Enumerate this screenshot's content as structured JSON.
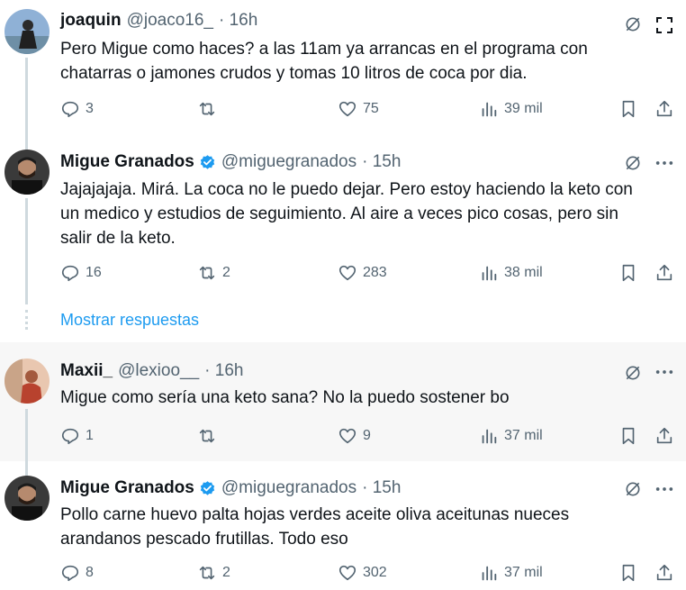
{
  "tweets": [
    {
      "name": "joaquin",
      "handle": "@joaco16_",
      "time": "· 16h",
      "text_lines": [
        "Pero Migue como haces? a las 11am ya arrancas en el programa con",
        "chatarras o jamones crudos y tomas 10 litros de coca por dia."
      ],
      "replies": "3",
      "retweets": "",
      "likes": "75",
      "views": "39 mil",
      "verified": false
    },
    {
      "name": "Migue Granados",
      "handle": "@miguegranados",
      "time": "· 15h",
      "text_lines": [
        "Jajajajaja. Mirá. La coca no le puedo dejar. Pero estoy haciendo la keto con",
        "un medico y estudios de seguimiento. Al aire a veces pico cosas, pero sin",
        "salir de la keto."
      ],
      "replies": "16",
      "retweets": "2",
      "likes": "283",
      "views": "38 mil",
      "verified": true
    },
    {
      "name": "Maxii_",
      "handle": "@lexioo__",
      "time": "· 16h",
      "text_lines": [
        "Migue como sería una keto sana? No la puedo sostener bo"
      ],
      "replies": "1",
      "retweets": "",
      "likes": "9",
      "views": "37 mil",
      "verified": false
    },
    {
      "name": "Migue Granados",
      "handle": "@miguegranados",
      "time": "· 15h",
      "text_lines": [
        "Pollo carne huevo palta hojas verdes aceite oliva aceitunas nueces",
        "arandanos pescado frutillas. Todo eso"
      ],
      "replies": "8",
      "retweets": "2",
      "likes": "302",
      "views": "37 mil",
      "verified": true
    }
  ],
  "show_replies_label": "Mostrar respuestas",
  "colors": {
    "accent": "#1d9bf0",
    "muted": "#536471",
    "text": "#0f1419",
    "highlight_bg": "#f7f7f7"
  },
  "icons": [
    "reply-icon",
    "retweet-icon",
    "like-icon",
    "views-icon",
    "bookmark-icon",
    "share-icon",
    "grok-icon",
    "more-icon",
    "expand-icon",
    "verified-badge-icon"
  ]
}
